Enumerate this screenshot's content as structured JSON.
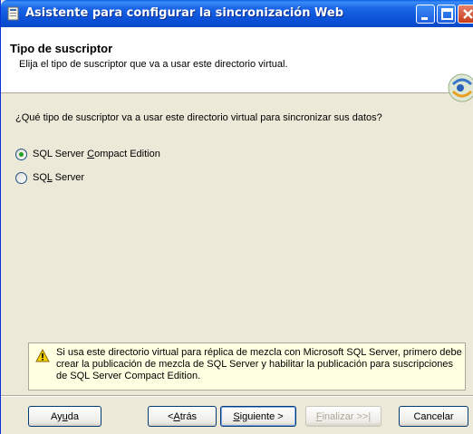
{
  "window": {
    "title": "Asistente para configurar la sincronización Web",
    "title_icon": "wizard-app-icon",
    "controls": [
      "minimize-icon",
      "maximize-icon",
      "close-icon"
    ]
  },
  "header": {
    "title": "Tipo de suscriptor",
    "subtitle": "Elija el tipo de suscriptor que va a usar este directorio virtual.",
    "icon": "sync-wizard-icon"
  },
  "body": {
    "question": "¿Qué tipo de suscriptor va a usar este directorio virtual para sincronizar sus datos?",
    "options": [
      {
        "label_pre": "SQL Server ",
        "label_accel": "C",
        "label_post": "ompact Edition",
        "selected": true
      },
      {
        "label_pre": "SQ",
        "label_accel": "L",
        "label_post": " Server",
        "selected": false
      }
    ]
  },
  "warning": {
    "icon": "warning-icon",
    "text": "Si usa este directorio virtual para réplica de mezcla con Microsoft SQL Server, primero debe crear la publicación de mezcla de SQL Server y habilitar la publicación para suscripciones de SQL Server Compact Edition."
  },
  "buttons": {
    "help": {
      "pre": "Ay",
      "accel": "u",
      "post": "da"
    },
    "back": {
      "pre": "< ",
      "accel": "A",
      "post": "trás"
    },
    "next": {
      "pre": "",
      "accel": "S",
      "post": "iguiente >"
    },
    "finish": {
      "pre": "",
      "accel": "F",
      "post": "inalizar >>|"
    },
    "cancel": {
      "label": "Cancelar"
    }
  },
  "colors": {
    "titlebar": "#0b52d8",
    "dialog_bg": "#ece9d8",
    "warning_bg": "#ffffe1",
    "radio_dot": "#21a121"
  }
}
